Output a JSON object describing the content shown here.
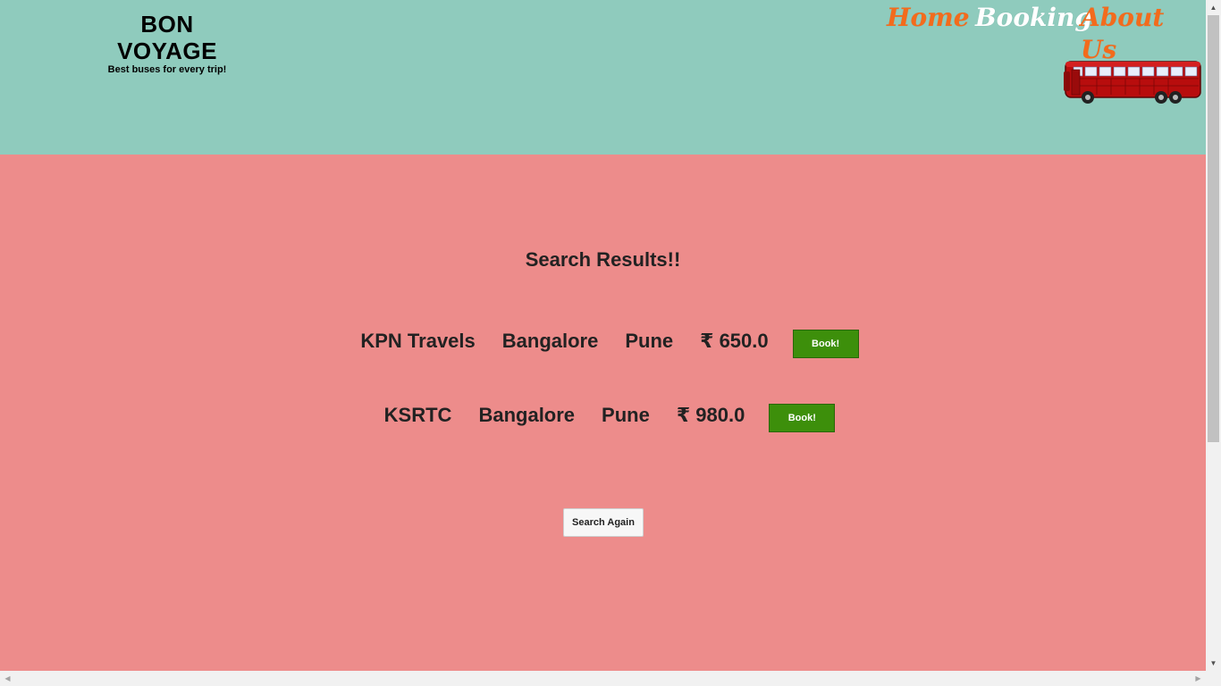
{
  "brand": {
    "title": "BON VOYAGE",
    "tagline": "Best buses for every trip!"
  },
  "nav": {
    "home": "Home",
    "booking": "Booking",
    "about": "About Us",
    "colors": {
      "home": "#f36b1c",
      "booking": "#ffffff",
      "about": "#f36b1c"
    }
  },
  "results": {
    "title": "Search Results!!",
    "rows": [
      {
        "operator": "KPN Travels",
        "from": "Bangalore",
        "to": "Pune",
        "price": "₹ 650.0",
        "book_label": "Book!"
      },
      {
        "operator": "KSRTC",
        "from": "Bangalore",
        "to": "Pune",
        "price": "₹ 980.0",
        "book_label": "Book!"
      }
    ],
    "search_again_label": "Search Again"
  },
  "colors": {
    "header_bg": "#8fcbbd",
    "body_bg": "#ed8c8b",
    "book_button": "#3d8f0b"
  }
}
